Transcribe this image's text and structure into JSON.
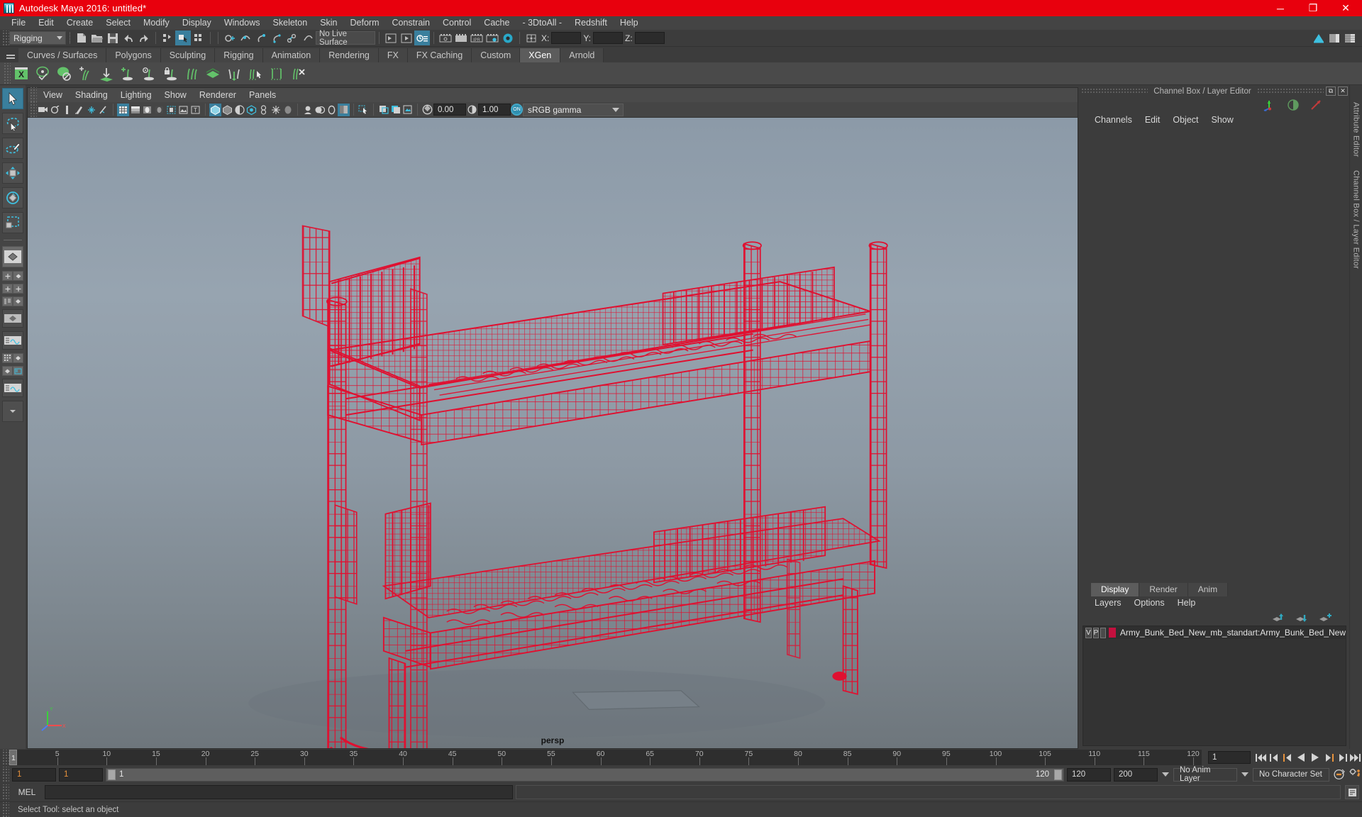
{
  "window": {
    "title": "Autodesk Maya 2016: untitled*",
    "minimize": "─",
    "maximize": "❐",
    "close": "✕"
  },
  "menubar": {
    "items": [
      "File",
      "Edit",
      "Create",
      "Select",
      "Modify",
      "Display",
      "Windows",
      "Skeleton",
      "Skin",
      "Deform",
      "Constrain",
      "Control",
      "Cache",
      "- 3DtoAll -",
      "Redshift",
      "Help"
    ]
  },
  "statusline": {
    "menu_set": "Rigging",
    "live_surface": "No Live Surface",
    "axis_labels": {
      "x": "X:",
      "y": "Y:",
      "z": "Z:"
    },
    "x_value": "",
    "y_value": "",
    "z_value": ""
  },
  "shelf": {
    "tabs": [
      "Curves / Surfaces",
      "Polygons",
      "Sculpting",
      "Rigging",
      "Animation",
      "Rendering",
      "FX",
      "FX Caching",
      "Custom",
      "XGen",
      "Arnold"
    ],
    "active_tab": "XGen"
  },
  "viewport_menu": {
    "items": [
      "View",
      "Shading",
      "Lighting",
      "Show",
      "Renderer",
      "Panels"
    ]
  },
  "viewport_toolbar": {
    "exposure_value": "0.00",
    "gamma_value": "1.00",
    "color_management_toggle": "ON",
    "view_transform": "sRGB gamma"
  },
  "viewport": {
    "camera_label": "persp",
    "model_color": "#e01030",
    "background_top": "#8c9aa8",
    "background_bottom": "#6e767c"
  },
  "right_panel": {
    "title": "Channel Box / Layer Editor",
    "channel_menu": [
      "Channels",
      "Edit",
      "Object",
      "Show"
    ],
    "layer_editor": {
      "tabs": [
        "Display",
        "Render",
        "Anim"
      ],
      "active_tab": "Display",
      "menu": [
        "Layers",
        "Options",
        "Help"
      ],
      "layers": [
        {
          "visibility": "V",
          "playback": "P",
          "type": "",
          "color": "#c3103e",
          "name": "Army_Bunk_Bed_New_mb_standart:Army_Bunk_Bed_New"
        }
      ]
    },
    "attribute_editor_tab": "Attribute Editor",
    "channel_box_tab": "Channel Box / Layer Editor"
  },
  "timeslider": {
    "ticks": [
      5,
      10,
      15,
      20,
      25,
      30,
      35,
      40,
      45,
      50,
      55,
      60,
      65,
      70,
      75,
      80,
      85,
      90,
      95,
      100,
      105,
      110,
      115,
      120
    ],
    "start": 1,
    "end": 120,
    "current_frame": "1",
    "current_frame_field": "1"
  },
  "rangebar": {
    "anim_start": "1",
    "range_start": "1",
    "slider_min_label": "1",
    "slider_max_label": "120",
    "range_end": "120",
    "anim_end": "200",
    "anim_layer": "No Anim Layer",
    "character_set": "No Character Set"
  },
  "commandline": {
    "language": "MEL",
    "input_value": "",
    "output_value": ""
  },
  "helpline": {
    "text": "Select Tool: select an object"
  }
}
